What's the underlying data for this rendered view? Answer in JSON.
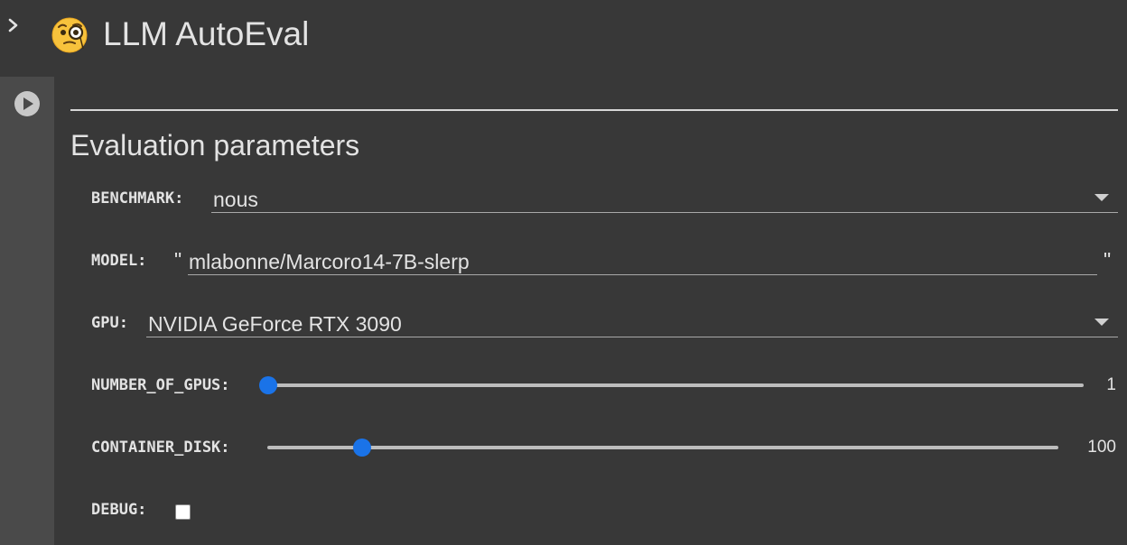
{
  "header": {
    "title": "LLM AutoEval",
    "emoji_icon": "monocle-face-emoji-icon"
  },
  "form": {
    "section_title": "Evaluation parameters",
    "benchmark": {
      "label": "BENCHMARK:",
      "value": "nous"
    },
    "model": {
      "label": "MODEL:",
      "open_quote": "\"",
      "value": "mlabonne/Marcoro14-7B-slerp",
      "close_quote": "\""
    },
    "gpu": {
      "label": "GPU:",
      "value": "NVIDIA GeForce RTX 3090"
    },
    "number_of_gpus": {
      "label": "NUMBER_OF_GPUS:",
      "value": "1",
      "level": 0.0
    },
    "container_disk": {
      "label": "CONTAINER_DISK:",
      "value": "100",
      "level": 0.12
    },
    "debug": {
      "label": "DEBUG:",
      "checked": false
    }
  },
  "colors": {
    "background": "#383838",
    "gutter": "#4a4a4a",
    "accent": "#1a73e8",
    "text": "#e3e3e3"
  }
}
